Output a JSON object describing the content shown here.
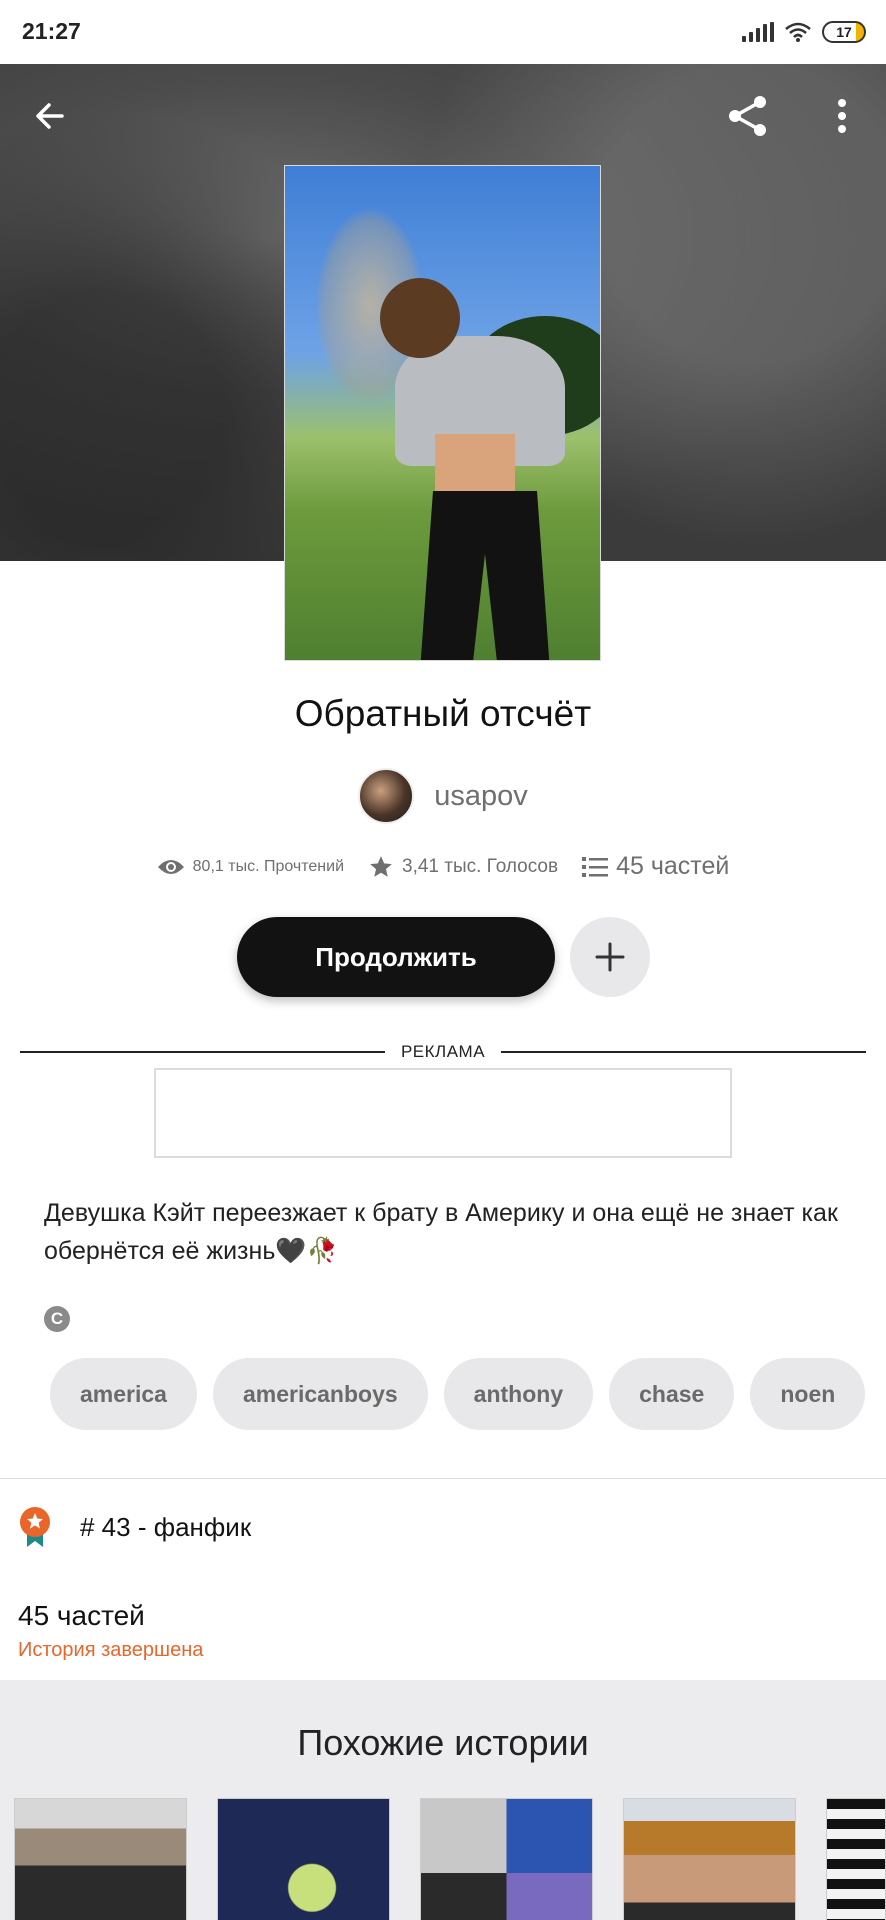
{
  "status_bar": {
    "time": "21:27",
    "battery": "17"
  },
  "story": {
    "title": "Обратный отсчёт",
    "author": "usapov",
    "reads": "80,1 тыс. Прочтений",
    "votes": "3,41 тыс. Голосов",
    "parts": "45 частей",
    "continue_label": "Продолжить",
    "ad_label": "РЕКЛАМА",
    "description": "Девушка Кэйт переезжает к брату в Америку и она ещё не знает как обернётся её жизнь🖤🥀",
    "copyright_symbol": "C",
    "tags": [
      "america",
      "americanboys",
      "anthony",
      "chase",
      "noen"
    ],
    "rank": "# 43 - фанфик",
    "parts_count": "45 частей",
    "status": "История завершена"
  },
  "similar": {
    "title": "Похожие истории"
  },
  "colors": {
    "accent": "#e8662a",
    "button": "#121212",
    "chip": "#e8e8ea"
  }
}
